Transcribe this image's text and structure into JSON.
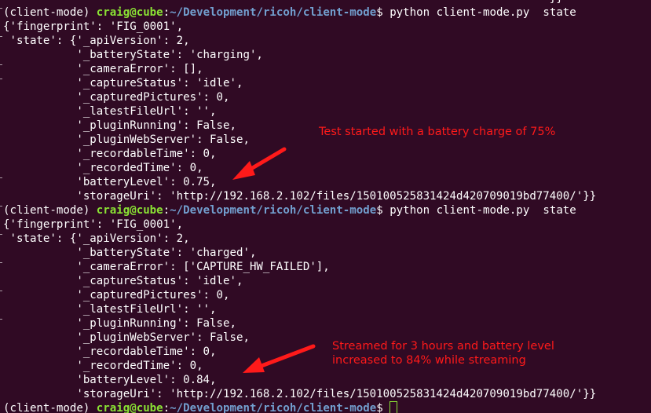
{
  "terminal": {
    "top_partial": "                                                                                 '}}",
    "block1": {
      "prompt_env": "(client-mode) ",
      "prompt_user": "craig@cube",
      "prompt_sep": ":",
      "prompt_path": "~/Development/ricoh/client-mode",
      "prompt_end": "$ ",
      "command": "python client-mode.py  state",
      "output": [
        "{'fingerprint': 'FIG_0001',",
        " 'state': {'_apiVersion': 2,",
        "           '_batteryState': 'charging',",
        "           '_cameraError': [],",
        "           '_captureStatus': 'idle',",
        "           '_capturedPictures': 0,",
        "           '_latestFileUrl': '',",
        "           '_pluginRunning': False,",
        "           '_pluginWebServer': False,",
        "           '_recordableTime': 0,",
        "           '_recordedTime': 0,",
        "           'batteryLevel': 0.75,",
        "           'storageUri': 'http://192.168.2.102/files/150100525831424d420709019bd77400/'}}"
      ]
    },
    "block2": {
      "prompt_env": "(client-mode) ",
      "prompt_user": "craig@cube",
      "prompt_sep": ":",
      "prompt_path": "~/Development/ricoh/client-mode",
      "prompt_end": "$ ",
      "command": "python client-mode.py  state",
      "output": [
        "{'fingerprint': 'FIG_0001',",
        " 'state': {'_apiVersion': 2,",
        "           '_batteryState': 'charged',",
        "           '_cameraError': ['CAPTURE_HW_FAILED'],",
        "           '_captureStatus': 'idle',",
        "           '_capturedPictures': 0,",
        "           '_latestFileUrl': '',",
        "           '_pluginRunning': False,",
        "           '_pluginWebServer': False,",
        "           '_recordableTime': 0,",
        "           '_recordedTime': 0,",
        "           'batteryLevel': 0.84,",
        "           'storageUri': 'http://192.168.2.102/files/150100525831424d420709019bd77400/'}}"
      ]
    },
    "final_prompt": {
      "prompt_env": "(client-mode) ",
      "prompt_user": "craig@cube",
      "prompt_sep": ":",
      "prompt_path": "~/Development/ricoh/client-mode",
      "prompt_end": "$ "
    }
  },
  "annotations": {
    "note1": "Test started with a battery charge of 75%",
    "note2_line1": "Streamed for 3 hours and battery level",
    "note2_line2": "increased to 84% while streaming"
  },
  "colors": {
    "background": "#300a24",
    "prompt_user": "#8ae234",
    "prompt_path": "#729fcf",
    "annotation": "#ff1a1a"
  }
}
